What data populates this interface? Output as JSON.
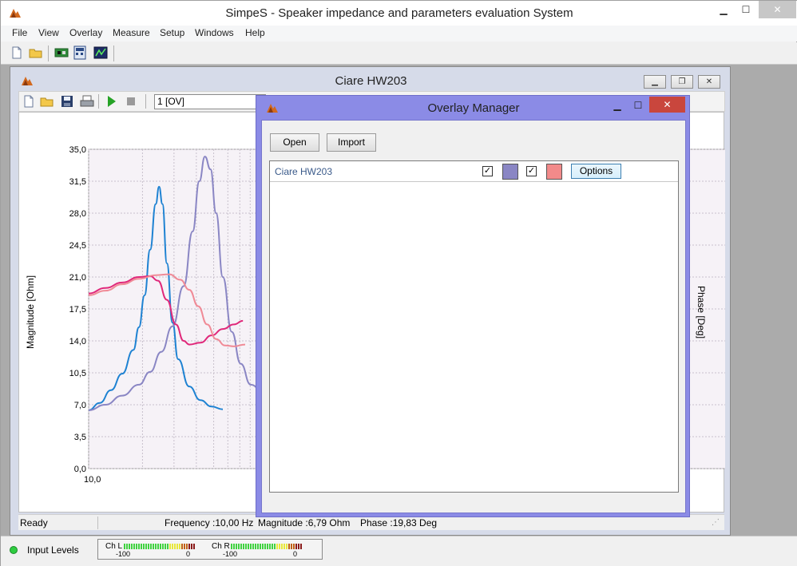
{
  "app": {
    "title": "SimpeS - Speaker impedance and parameters evaluation System"
  },
  "menu": [
    "File",
    "View",
    "Overlay",
    "Measure",
    "Setup",
    "Windows",
    "Help"
  ],
  "child": {
    "title": "Ciare HW203",
    "combo_value": "1 [OV]"
  },
  "status": {
    "ready": "Ready",
    "frequency": "Frequency :10,00 Hz",
    "magnitude": "Magnitude :6,79 Ohm",
    "phase": "Phase :19,83 Deg"
  },
  "bottom": {
    "input_levels": "Input Levels",
    "ch_l": "Ch L",
    "ch_r": "Ch R",
    "min": "-100",
    "max": "0"
  },
  "overlay": {
    "title": "Overlay Manager",
    "open": "Open",
    "import": "Import",
    "row_name": "Ciare HW203",
    "options": "Options",
    "swatch1_color": "#8a86c4",
    "swatch2_color": "#f28a8a"
  },
  "chart_data": {
    "type": "line",
    "ylabel": "Magnitude  [Ohm]",
    "y2label": "Phase  [Deg]",
    "yticks": [
      "35,0",
      "31,5",
      "28,0",
      "24,5",
      "21,0",
      "17,5",
      "14,0",
      "10,5",
      "7,0",
      "3,5",
      "0,0"
    ],
    "xticks": [
      "10,0"
    ],
    "ylim": [
      0,
      35
    ],
    "series": [
      {
        "color": "#1e82d2",
        "points": [
          [
            0,
            6.4
          ],
          [
            0.1,
            7.2
          ],
          [
            0.2,
            8.6
          ],
          [
            0.3,
            10.4
          ],
          [
            0.4,
            13.0
          ],
          [
            0.45,
            15.5
          ],
          [
            0.5,
            19.0
          ],
          [
            0.55,
            24.0
          ],
          [
            0.6,
            29.0
          ],
          [
            0.63,
            30.9
          ],
          [
            0.66,
            29.0
          ],
          [
            0.7,
            22.5
          ],
          [
            0.75,
            16.0
          ],
          [
            0.8,
            12.0
          ],
          [
            0.9,
            9.0
          ],
          [
            1.0,
            7.5
          ],
          [
            1.1,
            6.8
          ],
          [
            1.2,
            6.5
          ]
        ]
      },
      {
        "color": "#8a86c4",
        "points": [
          [
            0,
            6.4
          ],
          [
            0.15,
            7.0
          ],
          [
            0.3,
            8.0
          ],
          [
            0.45,
            9.2
          ],
          [
            0.55,
            10.6
          ],
          [
            0.65,
            12.8
          ],
          [
            0.75,
            15.6
          ],
          [
            0.85,
            20.0
          ],
          [
            0.93,
            26.0
          ],
          [
            0.99,
            31.5
          ],
          [
            1.04,
            34.2
          ],
          [
            1.09,
            32.8
          ],
          [
            1.14,
            28.0
          ],
          [
            1.2,
            21.0
          ],
          [
            1.28,
            15.0
          ],
          [
            1.36,
            11.5
          ],
          [
            1.45,
            9.2
          ],
          [
            1.6,
            7.6
          ]
        ]
      },
      {
        "color": "#e0287a",
        "points": [
          [
            0,
            19.2
          ],
          [
            0.15,
            19.8
          ],
          [
            0.3,
            20.4
          ],
          [
            0.45,
            21.0
          ],
          [
            0.55,
            21.1
          ],
          [
            0.62,
            20.6
          ],
          [
            0.7,
            18.5
          ],
          [
            0.78,
            15.8
          ],
          [
            0.85,
            14.0
          ],
          [
            0.9,
            13.6
          ],
          [
            1.0,
            13.8
          ],
          [
            1.1,
            14.6
          ],
          [
            1.2,
            15.3
          ],
          [
            1.3,
            15.8
          ],
          [
            1.38,
            16.2
          ]
        ]
      },
      {
        "color": "#f08a96",
        "points": [
          [
            0,
            19.0
          ],
          [
            0.15,
            19.5
          ],
          [
            0.3,
            20.2
          ],
          [
            0.45,
            20.8
          ],
          [
            0.6,
            21.2
          ],
          [
            0.72,
            21.3
          ],
          [
            0.82,
            20.7
          ],
          [
            0.9,
            19.6
          ],
          [
            0.98,
            17.8
          ],
          [
            1.06,
            15.8
          ],
          [
            1.14,
            14.2
          ],
          [
            1.22,
            13.5
          ],
          [
            1.3,
            13.4
          ],
          [
            1.4,
            13.6
          ]
        ]
      }
    ]
  }
}
